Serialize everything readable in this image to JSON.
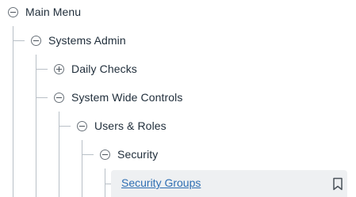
{
  "tree": {
    "main_menu": {
      "label": "Main Menu",
      "state": "expanded",
      "icon": "collapse-circle-icon"
    },
    "systems_admin": {
      "label": "Systems Admin",
      "state": "expanded",
      "icon": "collapse-circle-icon"
    },
    "daily_checks": {
      "label": "Daily Checks",
      "state": "collapsed",
      "icon": "expand-circle-icon"
    },
    "system_wide_controls": {
      "label": "System Wide Controls",
      "state": "expanded",
      "icon": "collapse-circle-icon"
    },
    "users_roles": {
      "label": "Users & Roles",
      "state": "expanded",
      "icon": "collapse-circle-icon"
    },
    "security": {
      "label": "Security",
      "state": "expanded",
      "icon": "collapse-circle-icon"
    },
    "security_groups": {
      "label": "Security Groups",
      "selected": true,
      "action_icon": "bookmark-icon"
    }
  },
  "colors": {
    "text": "#1f2d3a",
    "link": "#2f6fb3",
    "tree_line": "#b9c0c7",
    "selected_bg": "#eef0f2"
  }
}
